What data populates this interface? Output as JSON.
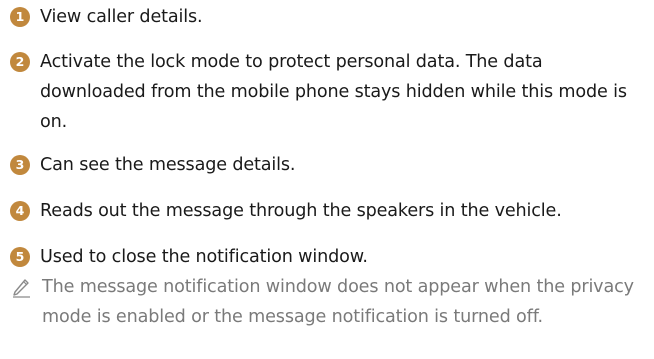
{
  "items": [
    {
      "number": "1",
      "text": "View caller details."
    },
    {
      "number": "2",
      "text": "Activate the lock mode to protect personal data. The data downloaded from the mobile phone stays hidden while this mode is on."
    },
    {
      "number": "3",
      "text": "Can see the message details."
    },
    {
      "number": "4",
      "text": "Reads out the message through the speakers in the vehicle."
    },
    {
      "number": "5",
      "text": "Used to close the notification window."
    }
  ],
  "note": {
    "icon": "pencil-note-icon",
    "text": "The message notification window does not appear when the privacy mode is enabled or the message notification is turned off."
  },
  "colors": {
    "badge": "#c1883d",
    "text": "#1a1a1a",
    "note_text": "#7a7a7a"
  }
}
